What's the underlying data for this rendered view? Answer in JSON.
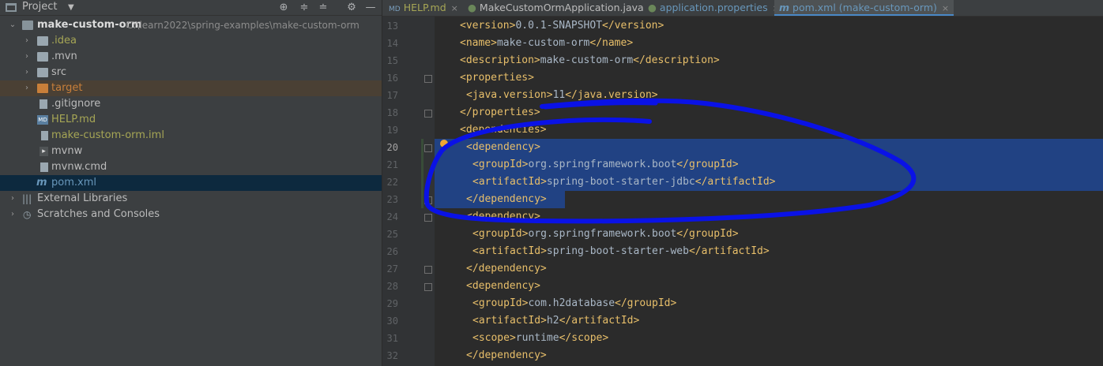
{
  "project_panel": {
    "title": "Project",
    "tree": [
      {
        "label": "make-custom-orm",
        "path": "C:\\learn2022\\spring-examples\\make-custom-orm",
        "type": "root",
        "color": "#dcdcdc"
      },
      {
        "label": ".idea",
        "type": "folder",
        "color": "#a6a655"
      },
      {
        "label": ".mvn",
        "type": "folder",
        "color": "#bbbbbb"
      },
      {
        "label": "src",
        "type": "folder",
        "color": "#bbbbbb"
      },
      {
        "label": "target",
        "type": "folder-excluded",
        "color": "#c87f3a"
      },
      {
        "label": ".gitignore",
        "type": "file",
        "color": "#bbbbbb"
      },
      {
        "label": "HELP.md",
        "type": "md-file",
        "color": "#a6a655"
      },
      {
        "label": "make-custom-orm.iml",
        "type": "iml-file",
        "color": "#a6a655"
      },
      {
        "label": "mvnw",
        "type": "script-file",
        "color": "#bbbbbb"
      },
      {
        "label": "mvnw.cmd",
        "type": "file",
        "color": "#bbbbbb"
      },
      {
        "label": "pom.xml",
        "type": "maven-file",
        "color": "#6897bb"
      },
      {
        "label": "External Libraries",
        "type": "libraries",
        "color": "#bbbbbb"
      },
      {
        "label": "Scratches and Consoles",
        "type": "scratches",
        "color": "#bbbbbb"
      }
    ]
  },
  "tabs": [
    {
      "label": "HELP.md",
      "color": "#a6a655",
      "icon": "markdown-icon"
    },
    {
      "label": "MakeCustomOrmApplication.java",
      "color": "#bbbbbb",
      "icon": "spring-class-icon"
    },
    {
      "label": "application.properties",
      "color": "#6897bb",
      "icon": "spring-config-icon"
    },
    {
      "label": "pom.xml (make-custom-orm)",
      "color": "#6897bb",
      "icon": "maven-icon",
      "active": true
    }
  ],
  "editor": {
    "lines": [
      {
        "n": "13",
        "text": "<version>0.0.1-SNAPSHOT</version>"
      },
      {
        "n": "14",
        "text": "<name>make-custom-orm</name>"
      },
      {
        "n": "15",
        "text": "<description>make-custom-orm</description>"
      },
      {
        "n": "16",
        "text": "<properties>"
      },
      {
        "n": "17",
        "text": "<java.version>11</java.version>"
      },
      {
        "n": "18",
        "text": "</properties>"
      },
      {
        "n": "19",
        "text": "<dependencies>"
      },
      {
        "n": "20",
        "text": "<dependency>"
      },
      {
        "n": "21",
        "text": "<groupId>org.springframework.boot</groupId>"
      },
      {
        "n": "22",
        "text": "<artifactId>spring-boot-starter-jdbc</artifactId>"
      },
      {
        "n": "23",
        "text": "</dependency>"
      },
      {
        "n": "24",
        "text": "<dependency>"
      },
      {
        "n": "25",
        "text": "<groupId>org.springframework.boot</groupId>"
      },
      {
        "n": "26",
        "text": "<artifactId>spring-boot-starter-web</artifactId>"
      },
      {
        "n": "27",
        "text": "</dependency>"
      },
      {
        "n": "28",
        "text": "<dependency>"
      },
      {
        "n": "29",
        "text": "<groupId>com.h2database</groupId>"
      },
      {
        "n": "30",
        "text": "<artifactId>h2</artifactId>"
      },
      {
        "n": "31",
        "text": "<scope>runtime</scope>"
      },
      {
        "n": "32",
        "text": "</dependency>"
      }
    ],
    "current_line": "20",
    "selected_lines": [
      "20",
      "21",
      "22",
      "23"
    ]
  },
  "colors": {
    "tag": "#e8bf6a",
    "text": "#a9b7c6",
    "selection": "#214283",
    "annotation": "#0a12e6"
  }
}
